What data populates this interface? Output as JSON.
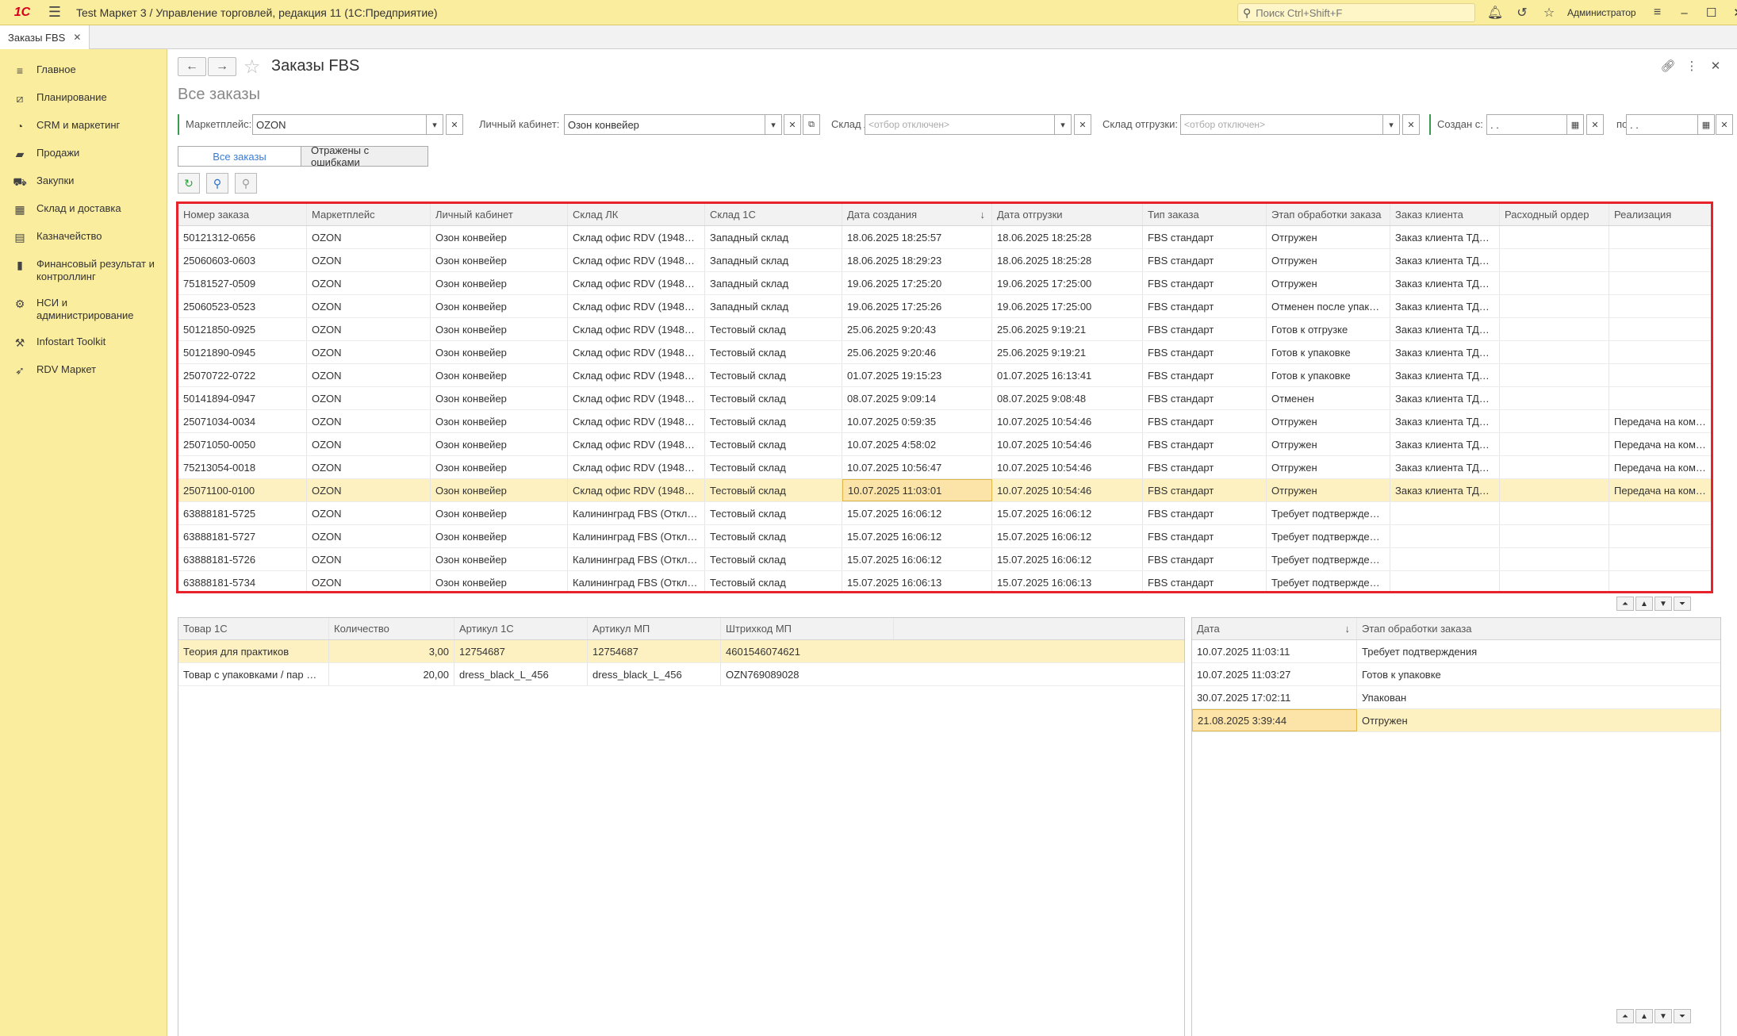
{
  "app": {
    "logo_text": "1С",
    "title": "Test Маркет 3 / Управление торговлей, редакция 11  (1С:Предприятие)",
    "search_placeholder": "Поиск Ctrl+Shift+F",
    "user": "Администратор"
  },
  "tabs": [
    {
      "label": "Заказы FBS"
    }
  ],
  "sidebar": {
    "items": [
      {
        "label": "Главное",
        "icon": "menu-lines-icon"
      },
      {
        "label": "Планирование",
        "icon": "chart-icon"
      },
      {
        "label": "CRM и маркетинг",
        "icon": "pie-icon"
      },
      {
        "label": "Продажи",
        "icon": "bag-icon"
      },
      {
        "label": "Закупки",
        "icon": "cart-icon"
      },
      {
        "label": "Склад и доставка",
        "icon": "warehouse-icon"
      },
      {
        "label": "Казначейство",
        "icon": "money-icon"
      },
      {
        "label": "Финансовый результат и контроллинг",
        "icon": "bar-chart-icon"
      },
      {
        "label": "НСИ и администрирование",
        "icon": "gear-icon"
      },
      {
        "label": "Infostart Toolkit",
        "icon": "tools-icon"
      },
      {
        "label": "RDV Маркет",
        "icon": "rocket-icon"
      }
    ]
  },
  "form": {
    "title": "Заказы FBS",
    "subtitle": "Все заказы"
  },
  "filters": {
    "marketplace_label": "Маркетплейс:",
    "marketplace_value": "OZON",
    "cabinet_label": "Личный кабинет:",
    "cabinet_value": "Озон конвейер",
    "warehouse_label": "Склад ЛК:",
    "warehouse_placeholder": "<отбор отключен>",
    "ship_label": "Склад отгрузки:",
    "ship_placeholder": "<отбор отключен>",
    "created_label": "Создан с:",
    "created_value": " .  .",
    "to_label": "по:",
    "to_value": " .  ."
  },
  "segments": {
    "all": "Все заказы",
    "errors": "Отражены с ошибками"
  },
  "orders": {
    "columns": [
      "Номер заказа",
      "Маркетплейс",
      "Личный кабинет",
      "Склад ЛК",
      "Склад 1С",
      "Дата создания",
      "Дата отгрузки",
      "Тип заказа",
      "Этап обработки заказа",
      "Заказ клиента",
      "Расходный ордер",
      "Реализация"
    ],
    "sort_indicator": "↓",
    "rows": [
      [
        "50121312-0656",
        "OZON",
        "Озон конвейер",
        "Склад офис RDV (1948…",
        "Западный склад",
        "18.06.2025 18:25:57",
        "18.06.2025 18:25:28",
        "FBS стандарт",
        "Отгружен",
        "Заказ клиента ТД…",
        "",
        ""
      ],
      [
        "25060603-0603",
        "OZON",
        "Озон конвейер",
        "Склад офис RDV (1948…",
        "Западный склад",
        "18.06.2025 18:29:23",
        "18.06.2025 18:25:28",
        "FBS стандарт",
        "Отгружен",
        "Заказ клиента ТД…",
        "",
        ""
      ],
      [
        "75181527-0509",
        "OZON",
        "Озон конвейер",
        "Склад офис RDV (1948…",
        "Западный склад",
        "19.06.2025 17:25:20",
        "19.06.2025 17:25:00",
        "FBS стандарт",
        "Отгружен",
        "Заказ клиента ТД…",
        "",
        ""
      ],
      [
        "25060523-0523",
        "OZON",
        "Озон конвейер",
        "Склад офис RDV (1948…",
        "Западный склад",
        "19.06.2025 17:25:26",
        "19.06.2025 17:25:00",
        "FBS стандарт",
        "Отменен после упак…",
        "Заказ клиента ТД…",
        "",
        ""
      ],
      [
        "50121850-0925",
        "OZON",
        "Озон конвейер",
        "Склад офис RDV (1948…",
        "Тестовый склад",
        "25.06.2025 9:20:43",
        "25.06.2025 9:19:21",
        "FBS стандарт",
        "Готов к отгрузке",
        "Заказ клиента ТД…",
        "",
        ""
      ],
      [
        "50121890-0945",
        "OZON",
        "Озон конвейер",
        "Склад офис RDV (1948…",
        "Тестовый склад",
        "25.06.2025 9:20:46",
        "25.06.2025 9:19:21",
        "FBS стандарт",
        "Готов к упаковке",
        "Заказ клиента ТД…",
        "",
        ""
      ],
      [
        "25070722-0722",
        "OZON",
        "Озон конвейер",
        "Склад офис RDV (1948…",
        "Тестовый склад",
        "01.07.2025 19:15:23",
        "01.07.2025 16:13:41",
        "FBS стандарт",
        "Готов к упаковке",
        "Заказ клиента ТД…",
        "",
        ""
      ],
      [
        "50141894-0947",
        "OZON",
        "Озон конвейер",
        "Склад офис RDV (1948…",
        "Тестовый склад",
        "08.07.2025 9:09:14",
        "08.07.2025 9:08:48",
        "FBS стандарт",
        "Отменен",
        "Заказ клиента ТД…",
        "",
        ""
      ],
      [
        "25071034-0034",
        "OZON",
        "Озон конвейер",
        "Склад офис RDV (1948…",
        "Тестовый склад",
        "10.07.2025 0:59:35",
        "10.07.2025 10:54:46",
        "FBS стандарт",
        "Отгружен",
        "Заказ клиента ТД…",
        "",
        "Передача на ком…"
      ],
      [
        "25071050-0050",
        "OZON",
        "Озон конвейер",
        "Склад офис RDV (1948…",
        "Тестовый склад",
        "10.07.2025 4:58:02",
        "10.07.2025 10:54:46",
        "FBS стандарт",
        "Отгружен",
        "Заказ клиента ТД…",
        "",
        "Передача на ком…"
      ],
      [
        "75213054-0018",
        "OZON",
        "Озон конвейер",
        "Склад офис RDV (1948…",
        "Тестовый склад",
        "10.07.2025 10:56:47",
        "10.07.2025 10:54:46",
        "FBS стандарт",
        "Отгружен",
        "Заказ клиента ТД…",
        "",
        "Передача на ком…"
      ],
      [
        "25071100-0100",
        "OZON",
        "Озон конвейер",
        "Склад офис RDV (1948…",
        "Тестовый склад",
        "10.07.2025 11:03:01",
        "10.07.2025 10:54:46",
        "FBS стандарт",
        "Отгружен",
        "Заказ клиента ТД…",
        "",
        "Передача на ком…"
      ],
      [
        "63888181-5725",
        "OZON",
        "Озон конвейер",
        "Калининград FBS (Откл…",
        "Тестовый склад",
        "15.07.2025 16:06:12",
        "15.07.2025 16:06:12",
        "FBS стандарт",
        "Требует подтвержде…",
        "",
        "",
        ""
      ],
      [
        "63888181-5727",
        "OZON",
        "Озон конвейер",
        "Калининград FBS (Откл…",
        "Тестовый склад",
        "15.07.2025 16:06:12",
        "15.07.2025 16:06:12",
        "FBS стандарт",
        "Требует подтвержде…",
        "",
        "",
        ""
      ],
      [
        "63888181-5726",
        "OZON",
        "Озон конвейер",
        "Калининград FBS (Откл…",
        "Тестовый склад",
        "15.07.2025 16:06:12",
        "15.07.2025 16:06:12",
        "FBS стандарт",
        "Требует подтвержде…",
        "",
        "",
        ""
      ],
      [
        "63888181-5734",
        "OZON",
        "Озон конвейер",
        "Калининград FBS (Откл…",
        "Тестовый склад",
        "15.07.2025 16:06:13",
        "15.07.2025 16:06:13",
        "FBS стандарт",
        "Требует подтвержде…",
        "",
        "",
        ""
      ]
    ]
  },
  "goods": {
    "columns": [
      "Товар 1С",
      "Количество",
      "Артикул 1С",
      "Артикул МП",
      "Штрихкод МП"
    ],
    "rows": [
      [
        "Теория для практиков",
        "3,00",
        "12754687",
        "12754687",
        "4601546074621"
      ],
      [
        "Товар с упаковками / пар …",
        "20,00",
        "dress_black_L_456",
        "dress_black_L_456",
        "OZN769089028"
      ]
    ]
  },
  "stages": {
    "columns": [
      "Дата",
      "Этап обработки заказа"
    ],
    "sort_indicator": "↓",
    "rows": [
      [
        "10.07.2025 11:03:11",
        "Требует подтверждения"
      ],
      [
        "10.07.2025 11:03:27",
        "Готов к упаковке"
      ],
      [
        "30.07.2025 17:02:11",
        "Упакован"
      ],
      [
        "21.08.2025 3:39:44",
        "Отгружен"
      ]
    ]
  }
}
